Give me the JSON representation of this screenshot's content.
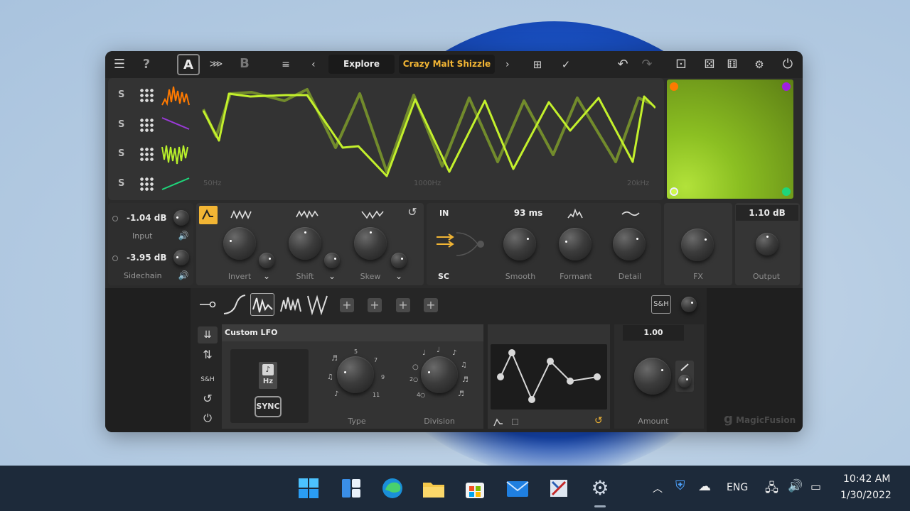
{
  "toolbar": {
    "menu_icon": "hamburger-icon",
    "help_icon": "question-icon",
    "a_label": "A",
    "b_label": "B",
    "explore_label": "Explore",
    "preset_name": "Crazy Malt Shizzle",
    "prev_arrow": "‹",
    "next_arrow": "›",
    "power_icon": "power-icon"
  },
  "spectrum": {
    "rows": [
      {
        "s": "S",
        "color": "#ff7a00"
      },
      {
        "s": "S",
        "color": "#a040e0"
      },
      {
        "s": "S",
        "color": "#b8f02a"
      },
      {
        "s": "S",
        "color": "#1ed67a"
      }
    ],
    "freq_labels": [
      "50Hz",
      "1000Hz",
      "20kHz"
    ]
  },
  "io": {
    "input_value": "-1.04 dB",
    "input_label": "Input",
    "sidechain_value": "-3.95 dB",
    "sidechain_label": "Sidechain"
  },
  "shapes": {
    "invert_label": "Invert",
    "shift_label": "Shift",
    "skew_label": "Skew"
  },
  "filter": {
    "in_label": "IN",
    "sc_label": "SC",
    "smooth_value": "93 ms",
    "smooth_label": "Smooth",
    "formant_label": "Formant",
    "detail_label": "Detail"
  },
  "fx": {
    "fx_label": "FX",
    "output_value": "1.10 dB",
    "output_label": "Output"
  },
  "modulation": {
    "sh_label": "S&H",
    "lfo_title": "Custom LFO",
    "hz_label": "Hz",
    "sync_label": "SYNC",
    "type_label": "Type",
    "division_label": "Division",
    "type_ticks": [
      "5",
      "7",
      "9",
      "11"
    ],
    "division_ticks": [
      "2○",
      "4○"
    ],
    "amount_value": "1.00",
    "amount_label": "Amount",
    "side_sh": "S&H",
    "brand": "MagicFusion"
  },
  "taskbar": {
    "lang": "ENG",
    "time": "10:42 AM",
    "date": "1/30/2022"
  }
}
